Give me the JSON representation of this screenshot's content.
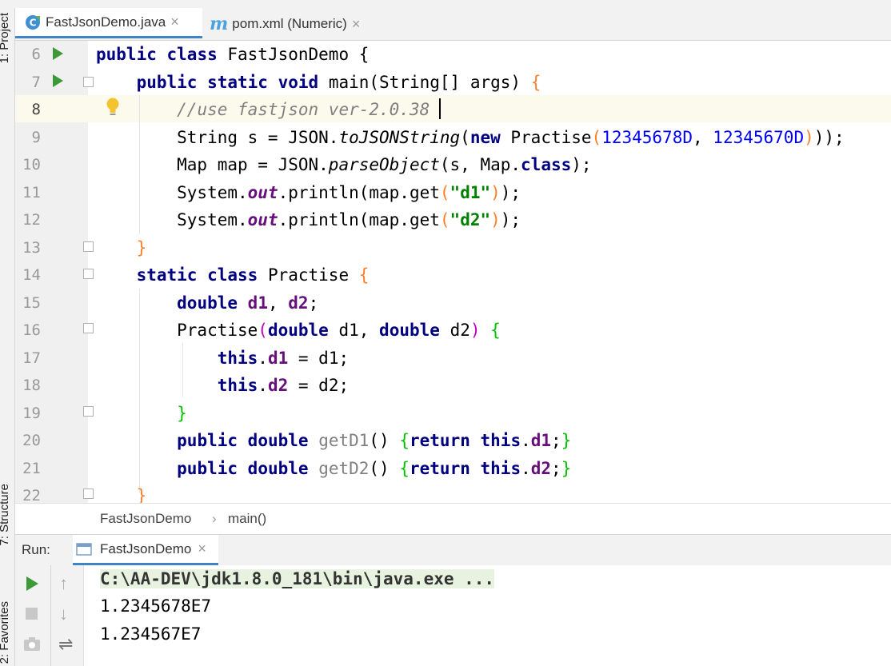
{
  "tabs": [
    {
      "label": "FastJsonDemo.java",
      "icon": "class-icon",
      "active": true
    },
    {
      "label": "pom.xml (Numeric)",
      "icon": "maven-icon",
      "active": false
    }
  ],
  "side_tools": {
    "project": "1: Project",
    "structure": "7: Structure",
    "favorites": "2: Favorites"
  },
  "lines": [
    {
      "n": "6",
      "tokens": [
        [
          "kw",
          "public "
        ],
        [
          "kw",
          "class "
        ],
        [
          "",
          "FastJsonDemo {"
        ]
      ]
    },
    {
      "n": "7",
      "tokens": [
        [
          "",
          "    "
        ],
        [
          "kw",
          "public "
        ],
        [
          "kw",
          "static "
        ],
        [
          "kw",
          "void "
        ],
        [
          "",
          "main(String[] args) "
        ],
        [
          "bo",
          "{"
        ]
      ]
    },
    {
      "n": "8",
      "tokens": [
        [
          "",
          "        "
        ],
        [
          "cm",
          "//use fastjson ver-2.0.38"
        ]
      ]
    },
    {
      "n": "9",
      "tokens": [
        [
          "",
          "        String s = JSON."
        ],
        [
          "it",
          "toJSONString"
        ],
        [
          "",
          "("
        ],
        [
          "kw",
          "new "
        ],
        [
          "",
          "Practise"
        ],
        [
          "bo",
          "("
        ],
        [
          "num",
          "12345678D"
        ],
        [
          "",
          ", "
        ],
        [
          "num",
          "12345670D"
        ],
        [
          "bo",
          ")"
        ],
        [
          "",
          "));"
        ]
      ]
    },
    {
      "n": "10",
      "tokens": [
        [
          "",
          "        Map map = JSON."
        ],
        [
          "it",
          "parseObject"
        ],
        [
          "",
          "(s, Map."
        ],
        [
          "kw",
          "class"
        ],
        [
          "",
          "); "
        ]
      ]
    },
    {
      "n": "11",
      "tokens": [
        [
          "",
          "        System."
        ],
        [
          "st",
          "out"
        ],
        [
          "",
          ".println(map.get"
        ],
        [
          "bo",
          "("
        ],
        [
          "str",
          "\"d1\""
        ],
        [
          "bo",
          ")"
        ],
        [
          "",
          ");"
        ]
      ]
    },
    {
      "n": "12",
      "tokens": [
        [
          "",
          "        System."
        ],
        [
          "st",
          "out"
        ],
        [
          "",
          ".println(map.get"
        ],
        [
          "bo",
          "("
        ],
        [
          "str",
          "\"d2\""
        ],
        [
          "bo",
          ")"
        ],
        [
          "",
          ");"
        ]
      ]
    },
    {
      "n": "13",
      "tokens": [
        [
          "",
          "    "
        ],
        [
          "bo",
          "}"
        ]
      ]
    },
    {
      "n": "14",
      "tokens": [
        [
          "",
          "    "
        ],
        [
          "kw",
          "static "
        ],
        [
          "kw",
          "class "
        ],
        [
          "",
          "Practise "
        ],
        [
          "bo",
          "{"
        ]
      ]
    },
    {
      "n": "15",
      "tokens": [
        [
          "",
          "        "
        ],
        [
          "kw",
          "double "
        ],
        [
          "fld",
          "d1"
        ],
        [
          "",
          ", "
        ],
        [
          "fld",
          "d2"
        ],
        [
          "",
          ";"
        ]
      ]
    },
    {
      "n": "16",
      "tokens": [
        [
          "",
          "        Practise"
        ],
        [
          "bp",
          "("
        ],
        [
          "kw",
          "double "
        ],
        [
          "",
          "d1, "
        ],
        [
          "kw",
          "double "
        ],
        [
          "",
          "d2"
        ],
        [
          "bp",
          ")"
        ],
        [
          "bg",
          " {"
        ]
      ]
    },
    {
      "n": "17",
      "tokens": [
        [
          "",
          "            "
        ],
        [
          "kw",
          "this"
        ],
        [
          "",
          "."
        ],
        [
          "fld",
          "d1"
        ],
        [
          "",
          " = d1;"
        ]
      ]
    },
    {
      "n": "18",
      "tokens": [
        [
          "",
          "            "
        ],
        [
          "kw",
          "this"
        ],
        [
          "",
          "."
        ],
        [
          "fld",
          "d2"
        ],
        [
          "",
          " = d2;"
        ]
      ]
    },
    {
      "n": "19",
      "tokens": [
        [
          "",
          "        "
        ],
        [
          "bg",
          "}"
        ]
      ]
    },
    {
      "n": "20",
      "tokens": [
        [
          "",
          "        "
        ],
        [
          "kw",
          "public "
        ],
        [
          "kw",
          "double "
        ],
        [
          "unused",
          "getD1"
        ],
        [
          "",
          "() "
        ],
        [
          "bg",
          "{"
        ],
        [
          "kw",
          "return "
        ],
        [
          "kw",
          "this"
        ],
        [
          "",
          "."
        ],
        [
          "fld",
          "d1"
        ],
        [
          "",
          ";"
        ],
        [
          "bg",
          "}"
        ]
      ]
    },
    {
      "n": "21",
      "tokens": [
        [
          "",
          "        "
        ],
        [
          "kw",
          "public "
        ],
        [
          "kw",
          "double "
        ],
        [
          "unused",
          "getD2"
        ],
        [
          "",
          "() "
        ],
        [
          "bg",
          "{"
        ],
        [
          "kw",
          "return "
        ],
        [
          "kw",
          "this"
        ],
        [
          "",
          "."
        ],
        [
          "fld",
          "d2"
        ],
        [
          "",
          ";"
        ],
        [
          "bg",
          "}"
        ]
      ]
    },
    {
      "n": "22",
      "tokens": [
        [
          "",
          "    "
        ],
        [
          "bo",
          "}"
        ]
      ]
    }
  ],
  "breadcrumb": {
    "class": "FastJsonDemo",
    "method": "main()"
  },
  "run_panel": {
    "label": "Run:",
    "tab": "FastJsonDemo"
  },
  "console": [
    "C:\\AA-DEV\\jdk1.8.0_181\\bin\\java.exe ...",
    "1.2345678E7",
    "1.234567E7"
  ]
}
